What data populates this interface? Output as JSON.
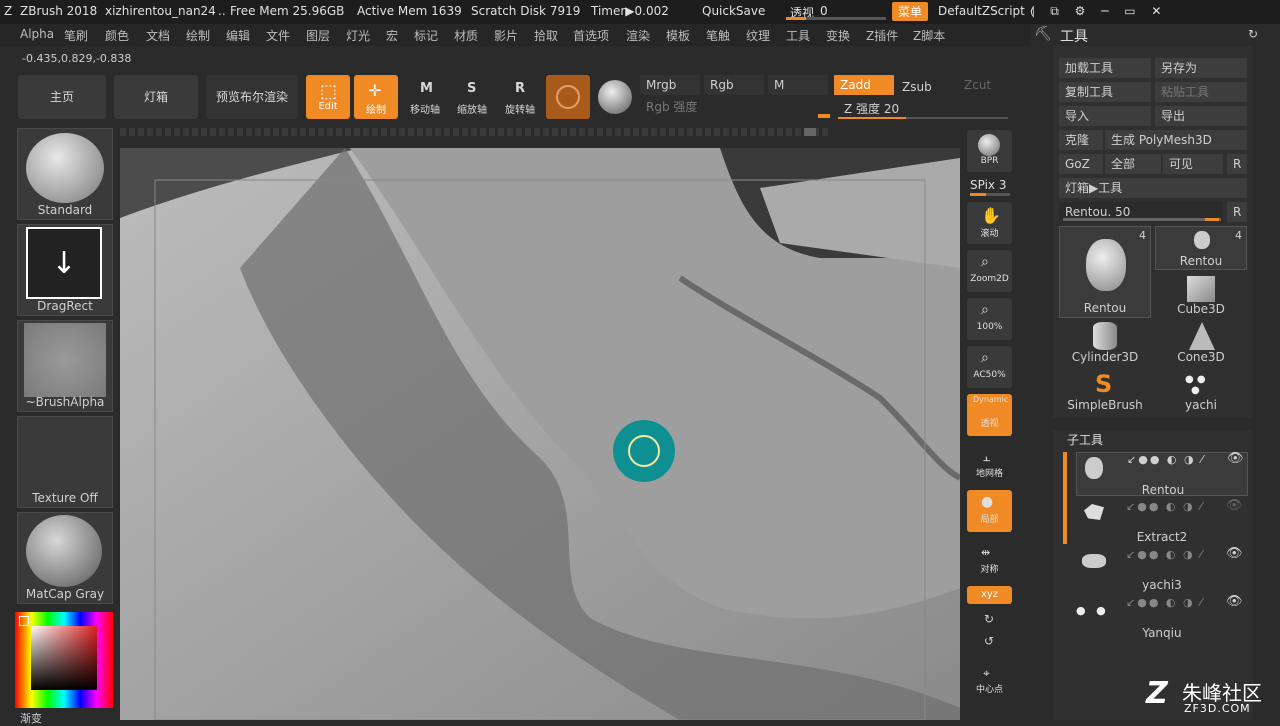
{
  "titlebar": {
    "app": "ZBrush 2018",
    "file": "xizhirentou_nan24",
    "dots": "..",
    "free_mem": "Free Mem 25.96GB",
    "active_mem": "Active Mem 1639",
    "scratch": "Scratch Disk 7919",
    "timer": "Timer▶0.002",
    "quicksave": "QuickSave",
    "perspective": "透视",
    "perspective_val": "0",
    "menu_btn": "菜单",
    "script": "DefaultZScript"
  },
  "menubar": [
    "Alpha",
    "笔刷",
    "颜色",
    "文档",
    "绘制",
    "编辑",
    "文件",
    "图层",
    "灯光",
    "宏",
    "标记",
    "材质",
    "影片",
    "拾取",
    "首选项",
    "渲染",
    "模板",
    "笔触",
    "纹理",
    "工具",
    "变换",
    "Z插件",
    "Z脚本"
  ],
  "coords": "-0.435,0.829,-0.838",
  "shelf": {
    "home": "主页",
    "lightbox": "灯箱",
    "bpr": "预览布尔渲染",
    "edit": "Edit",
    "draw": "绘制",
    "move": "移动轴",
    "scale": "缩放轴",
    "rotate": "旋转轴",
    "mrgb": "Mrgb",
    "rgb": "Rgb",
    "m": "M",
    "rgb_intensity": "Rgb 强度",
    "zadd": "Zadd",
    "zsub": "Zsub",
    "zcut": "Zcut",
    "z_intensity": "Z 强度 20"
  },
  "left": {
    "brush": "Standard",
    "stroke": "DragRect",
    "alpha": "~BrushAlpha",
    "texture": "Texture Off",
    "material": "MatCap Gray",
    "gradient": "渐变"
  },
  "rightcol": {
    "bpr": "BPR",
    "spix": "SPix 3",
    "scroll": "滚动",
    "zoom2d": "Zoom2D",
    "p100": "100%",
    "ac50": "AC50%",
    "dynamic": "Dynamic",
    "persp": "透视",
    "floor": "地网格",
    "local": "局部",
    "sym": "对称",
    "xyz": "xyz",
    "center": "中心点"
  },
  "toolpanel": {
    "title": "工具",
    "load": "加载工具",
    "saveas": "另存为",
    "copy": "复制工具",
    "paste": "粘贴工具",
    "import": "导入",
    "export": "导出",
    "clone": "克隆",
    "make_polymesh": "生成 PolyMesh3D",
    "goz": "GoZ",
    "all": "全部",
    "visible": "可见",
    "r": "R",
    "lightbox_tool": "灯箱▶工具",
    "rentou_slider": "Rentou. 50",
    "tools": [
      {
        "name": "Rentou",
        "count": "4"
      },
      {
        "name": "Rentou",
        "count": "4"
      },
      {
        "name": "Rentou",
        "count": ""
      },
      {
        "name": "Cube3D",
        "count": ""
      },
      {
        "name": "Cylinder3D",
        "count": ""
      },
      {
        "name": "Cone3D",
        "count": ""
      },
      {
        "name": "SimpleBrush",
        "count": ""
      },
      {
        "name": "yachi",
        "count": ""
      }
    ]
  },
  "subtool": {
    "title": "子工具",
    "items": [
      "Rentou",
      "Extract2",
      "yachi3",
      "Yanqiu"
    ]
  },
  "watermark": {
    "brand": "朱峰社区",
    "url": "ZF3D.COM"
  },
  "colors": {
    "accent": "#f08a24",
    "teal": "#0e8f91"
  }
}
